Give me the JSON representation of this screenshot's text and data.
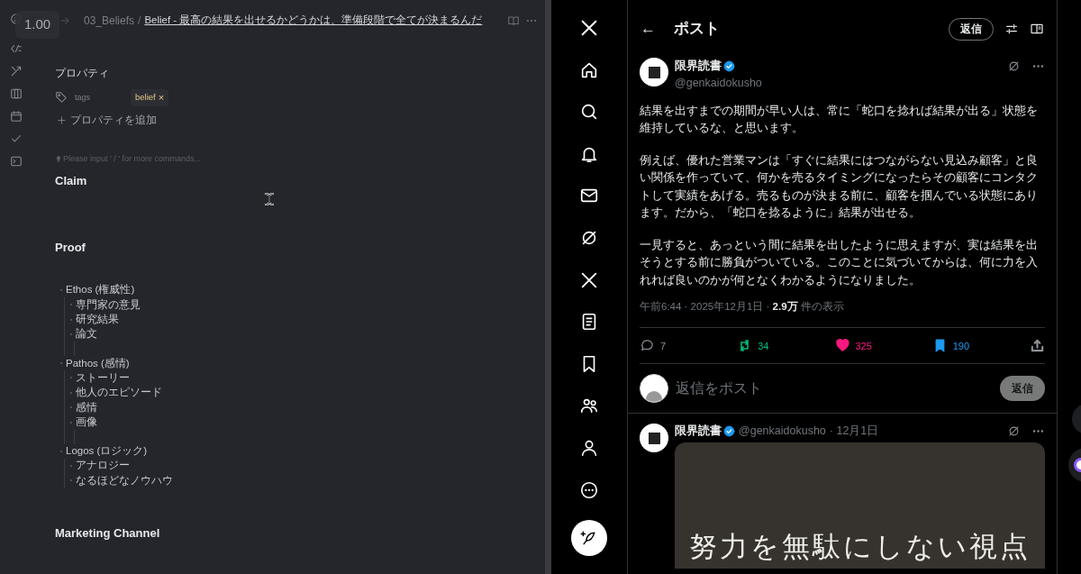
{
  "zoom_badge": "1.00",
  "editor": {
    "breadcrumb": {
      "folder": "03_Beliefs",
      "separator": "/",
      "title": "Belief - 最高の結果を出せるかどうかは、準備段階で全てが決まるんだ"
    },
    "properties": {
      "heading": "プロパティ",
      "tags_label": "tags",
      "tags": [
        {
          "label": "belief",
          "remove": "×"
        }
      ],
      "add_label": "プロパティを追加"
    },
    "placeholder": "Please input ' / ' for more commands...",
    "sections": [
      {
        "heading": "Claim"
      },
      {
        "heading": "Proof",
        "outline": [
          {
            "text": "Ethos (権威性)",
            "children": [
              {
                "text": "専門家の意見"
              },
              {
                "text": "研究結果"
              },
              {
                "text": "論文"
              }
            ]
          },
          {
            "text": "Pathos (感情)",
            "children": [
              {
                "text": "ストーリー"
              },
              {
                "text": "他人のエピソード"
              },
              {
                "text": "感情"
              },
              {
                "text": "画像"
              }
            ]
          },
          {
            "text": "Logos (ロジック)",
            "children": [
              {
                "text": "アナロジー"
              },
              {
                "text": "なるほどなノウハウ"
              }
            ]
          }
        ]
      },
      {
        "heading": "Marketing Channel"
      }
    ]
  },
  "x": {
    "header": {
      "back": "←",
      "title": "ポスト",
      "reply_button": "返信"
    },
    "post": {
      "name": "限界読書",
      "handle": "@genkaidokusho",
      "paragraphs": [
        "結果を出すまでの期間が早い人は、常に「蛇口を捻れば結果が出る」状態を維持しているな、と思います。",
        "例えば、優れた営業マンは「すぐに結果にはつながらない見込み顧客」と良い関係を作っていて、何かを売るタイミングになったらその顧客にコンタクトして実績をあげる。売るものが決まる前に、顧客を掴んでいる状態にあります。だから、「蛇口を捻るように」結果が出せる。",
        "一見すると、あっという間に結果を出したように思えますが、実は結果を出そうとする前に勝負がついている。このことに気づいてからは、何に力を入れれば良いのかが何となくわかるようになりました。"
      ],
      "time": "午前6:44 · 2025年12月1日 · ",
      "views": "2.9万",
      "views_label": " 件の表示",
      "actions": [
        {
          "kind": "reply",
          "count": "7",
          "color": "#8b8f94"
        },
        {
          "kind": "repost",
          "count": "34",
          "color": "#00ba7c"
        },
        {
          "kind": "like",
          "count": "325",
          "color": "#f91880"
        },
        {
          "kind": "bookmark",
          "count": "190",
          "color": "#1d9bf0"
        },
        {
          "kind": "share",
          "color": "#8b8f94"
        }
      ]
    },
    "composer": {
      "placeholder": "返信をポスト",
      "button": "返信"
    },
    "next_post": {
      "name": "限界読書",
      "handle": "@genkaidokusho",
      "date": "· 12月1日",
      "media_text": "努力を無駄にしない視点"
    }
  }
}
